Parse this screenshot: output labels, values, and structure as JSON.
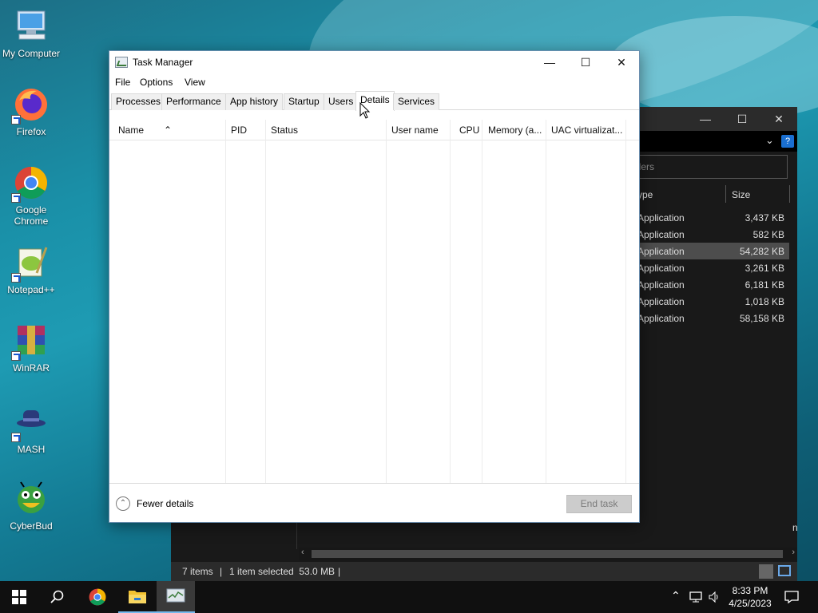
{
  "desktop": {
    "icons": [
      {
        "label": "My Computer",
        "icon": "computer-icon"
      },
      {
        "label": "Firefox",
        "icon": "firefox-icon"
      },
      {
        "label": "Google Chrome",
        "icon": "chrome-icon"
      },
      {
        "label": "Notepad++",
        "icon": "notepadpp-icon"
      },
      {
        "label": "WinRAR",
        "icon": "winrar-icon"
      },
      {
        "label": "MASH",
        "icon": "mash-icon"
      },
      {
        "label": "CyberBud",
        "icon": "cyberbud-icon"
      }
    ]
  },
  "explorer": {
    "search_placeholder": "llers",
    "columns": {
      "type": "ype",
      "size": "Size"
    },
    "rows": [
      {
        "type": "Application",
        "size": "3,437 KB"
      },
      {
        "type": "Application",
        "size": "582 KB"
      },
      {
        "type": "Application",
        "size": "54,282 KB"
      },
      {
        "type": "Application",
        "size": "3,261 KB"
      },
      {
        "type": "Application",
        "size": "6,181 KB"
      },
      {
        "type": "Application",
        "size": "1,018 KB"
      },
      {
        "type": "Application",
        "size": "58,158 KB"
      }
    ],
    "edge_text": "n",
    "status": {
      "items": "7 items",
      "separator": "|",
      "selected": "1 item selected  53.0 MB",
      "separator2": "|"
    }
  },
  "task_manager": {
    "title": "Task Manager",
    "menu": [
      "File",
      "Options",
      "View"
    ],
    "tabs": [
      "Processes",
      "Performance",
      "App history",
      "Startup",
      "Users",
      "Details",
      "Services"
    ],
    "active_tab": "Details",
    "columns": [
      "Name",
      "PID",
      "Status",
      "User name",
      "CPU",
      "Memory (a...",
      "UAC virtualizat..."
    ],
    "fewer_details": "Fewer details",
    "end_task": "End task",
    "window_buttons": {
      "minimize": "—",
      "maximize": "☐",
      "close": "✕"
    }
  },
  "taskbar": {
    "time": "8:33 PM",
    "date": "4/25/2023"
  }
}
